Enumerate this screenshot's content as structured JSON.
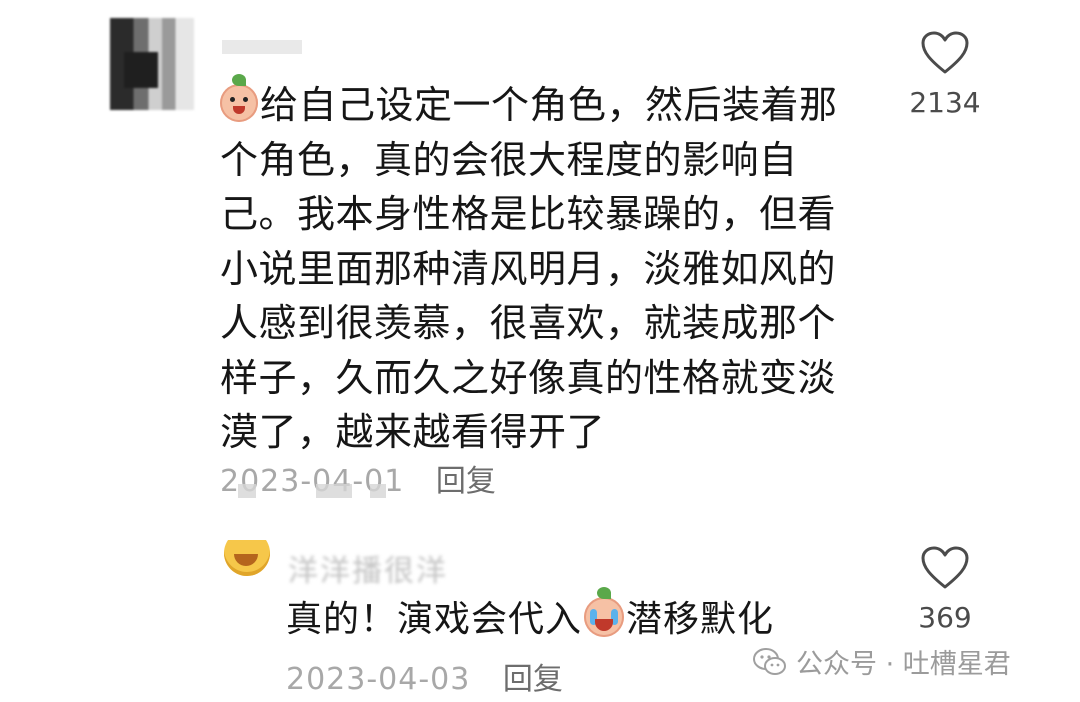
{
  "comments": [
    {
      "text": "给自己设定一个角色，然后装着那个角色，真的会很大程度的影响自己。我本身性格是比较暴躁的，但看小说里面那种清风明月，淡雅如风的人感到很羡慕，很喜欢，就装成那个样子，久而久之好像真的性格就变淡漠了，越来越看得开了",
      "date": "2023-04-01",
      "reply_label": "回复",
      "likes": "2134",
      "leading_emoji": "peach-face-emoji"
    },
    {
      "username_blurred": "洋洋播很洋",
      "text_before_emoji": "真的！演戏会代入",
      "inline_emoji": "crying-peach-emoji",
      "text_after_emoji": "潜移默化",
      "date": "2023-04-03",
      "reply_label": "回复",
      "likes": "369"
    }
  ],
  "watermark": {
    "text": "公众号 · 吐槽星君",
    "icon": "wechat-icon"
  },
  "colors": {
    "text": "#161616",
    "meta": "#a8a8a8",
    "like_icon": "#4b4b4b"
  }
}
